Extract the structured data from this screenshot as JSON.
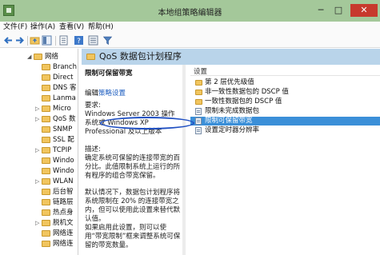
{
  "window": {
    "title": "本地组策略编辑器",
    "minimize": "─",
    "maximize": "□",
    "close": "✕"
  },
  "menu": [
    {
      "label": "文件(F)"
    },
    {
      "label": "操作(A)"
    },
    {
      "label": "查看(V)"
    },
    {
      "label": "帮助(H)"
    }
  ],
  "toolbar": {
    "icons": [
      "back-arrow-icon",
      "forward-arrow-icon",
      "up-folder-icon",
      "show-tree-icon",
      "properties-icon",
      "help-icon",
      "view-icon",
      "filter-icon"
    ]
  },
  "tree": {
    "items": [
      {
        "label": "网络",
        "expanded": true
      },
      {
        "label": "Branch"
      },
      {
        "label": "Direct"
      },
      {
        "label": "DNS 客"
      },
      {
        "label": "Lanma"
      },
      {
        "label": "Micro"
      },
      {
        "label": "QoS 数"
      },
      {
        "label": "SNMP"
      },
      {
        "label": "SSL 配"
      },
      {
        "label": "TCPIP"
      },
      {
        "label": "Windo"
      },
      {
        "label": "Windo"
      },
      {
        "label": "WLAN"
      },
      {
        "label": "后台智"
      },
      {
        "label": "链路层"
      },
      {
        "label": "热点身"
      },
      {
        "label": "脱机文"
      },
      {
        "label": "网络连"
      },
      {
        "label": "网络连"
      }
    ]
  },
  "pane": {
    "header": "QoS 数据包计划程序",
    "description": {
      "title": "限制可保留带宽",
      "edit_prefix": "编辑",
      "edit_link": "策略设置",
      "requirements_label": "要求:",
      "requirements": "Windows Server 2003 操作系统或 Windows XP Professional 及以上版本",
      "desc_label": "描述:",
      "description": "确定系统可保留的连接带宽的百分比。此值限制系统上运行的所有程序的组合带宽保留。",
      "default": "默认情况下，数据包计划程序将系统限制在 20% 的连接带宽之内，但可以使用此设置来替代默认值。",
      "enabled": "如果启用此设置，则可以使用“带宽限制”框来调整系统可保留的带宽数量。"
    },
    "settings": {
      "column": "设置",
      "rows": [
        {
          "label": "第 2 层优先级值",
          "type": "folder"
        },
        {
          "label": "非一致性数据包的 DSCP 值",
          "type": "folder"
        },
        {
          "label": "一致性数据包的 DSCP 值",
          "type": "folder"
        },
        {
          "label": "限制未完成数据包",
          "type": "policy"
        },
        {
          "label": "限制可保留带宽",
          "type": "policy",
          "selected": true
        },
        {
          "label": "设置定时器分辨率",
          "type": "policy"
        }
      ]
    }
  },
  "colors": {
    "titlebar": "#a4c89a",
    "header": "#b9d4ea",
    "selection": "#3b8fd8",
    "annotation": "#1f4fc2",
    "close": "#c7392d"
  }
}
